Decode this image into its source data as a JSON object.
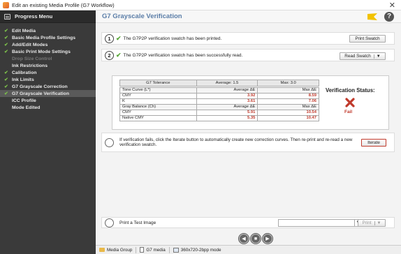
{
  "window": {
    "title": "Edit an existing Media Profile (G7 Workflow)",
    "close_glyph": "✕"
  },
  "sidebar": {
    "header": "Progress Menu",
    "items": [
      {
        "label": "Edit Media",
        "state": "done"
      },
      {
        "label": "Basic Media Profile Settings",
        "state": "done"
      },
      {
        "label": "Add/Edit Modes",
        "state": "done"
      },
      {
        "label": "Basic Print Mode Settings",
        "state": "done"
      },
      {
        "label": "Drop Size Control",
        "state": "disabled"
      },
      {
        "label": "Ink Restrictions",
        "state": "none"
      },
      {
        "label": "Calibration",
        "state": "done"
      },
      {
        "label": "Ink Limits",
        "state": "done"
      },
      {
        "label": "G7 Grayscale Correction",
        "state": "done"
      },
      {
        "label": "G7 Grayscale Verification",
        "state": "active"
      },
      {
        "label": "ICC Profile",
        "state": "none"
      },
      {
        "label": "Mode Edited",
        "state": "none"
      }
    ]
  },
  "main": {
    "title": "G7 Grayscale Verification",
    "help_glyph": "?",
    "step1": {
      "number": "1",
      "text": "The G7P2P verification swatch has been printed.",
      "button": "Print Swatch"
    },
    "step2": {
      "number": "2",
      "text": "The G7P2P verification swatch has been successfully read.",
      "button": "Read Swatch"
    },
    "results": {
      "tolerance_label": "G7 Tolerance",
      "average_label": "Average: 1.5",
      "max_label": "Max: 3.0",
      "tone_curve": {
        "header": "Tone Curve (L*)",
        "avg_header": "Average ΔE",
        "max_header": "Max ΔE",
        "rows": [
          {
            "name": "CMY",
            "avg": "3.92",
            "max": "8.59"
          },
          {
            "name": "K",
            "avg": "3.61",
            "max": "7.06"
          }
        ]
      },
      "gray_balance": {
        "header": "Gray Balance (Ch)",
        "avg_header": "Average ΔE",
        "max_header": "Max ΔE",
        "rows": [
          {
            "name": "CMY",
            "avg": "5.91",
            "max": "10.54"
          },
          {
            "name": "Native CMY",
            "avg": "5.35",
            "max": "10.47"
          }
        ]
      },
      "status_label": "Verification Status:",
      "status_value": "Fail"
    },
    "iterate": {
      "text": "If verification fails, click the Iterate button to automatically create new correction curves.  Then re-print and re-read a new verification swatch.",
      "button": "Iterate"
    },
    "test_image": {
      "label": "Print a Test Image",
      "select_value": "",
      "button": "Print"
    },
    "nav": {
      "prev": "◀",
      "stop": "■",
      "next": "▶"
    }
  },
  "statusbar": {
    "group": "Media Group",
    "media": "G7 media",
    "resolution": "360x720-2bpp mode"
  },
  "colors": {
    "title_blue": "#5b7ea8",
    "check_green": "#5aa83a",
    "fail_red": "#c0392b",
    "sidebar_bg": "#3a3a3a"
  }
}
